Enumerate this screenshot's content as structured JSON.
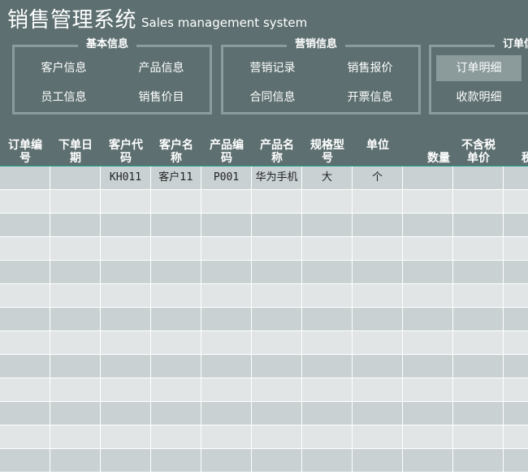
{
  "app": {
    "title_cn": "销售管理系统",
    "title_en": "Sales management system"
  },
  "groups": [
    {
      "title": "基本信息",
      "buttons": [
        "客户信息",
        "产品信息",
        "员工信息",
        "销售价目"
      ]
    },
    {
      "title": "营销信息",
      "buttons": [
        "营销记录",
        "销售报价",
        "合同信息",
        "开票信息"
      ]
    },
    {
      "title": "订单信",
      "buttons": [
        "订单明细",
        "收款明细"
      ]
    }
  ],
  "table": {
    "headers": [
      [
        "订单编",
        "号"
      ],
      [
        "下单日",
        "期"
      ],
      [
        "客户代",
        "码"
      ],
      [
        "客户名",
        "称"
      ],
      [
        "产品编",
        "码"
      ],
      [
        "产品名",
        "称"
      ],
      [
        "规格型",
        "号"
      ],
      [
        "单位"
      ],
      [
        "数量"
      ],
      [
        "不含税",
        "单价"
      ],
      [
        "税"
      ]
    ],
    "rows": [
      [
        "",
        "",
        "KH011",
        "客户11",
        "P001",
        "华为手机",
        "大",
        "个",
        "",
        "",
        ""
      ]
    ],
    "empty_row_count": 12
  }
}
